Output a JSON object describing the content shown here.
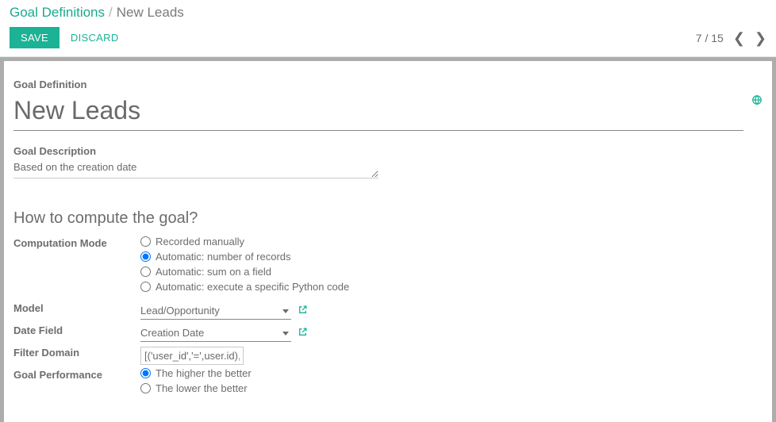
{
  "breadcrumb": {
    "parent": "Goal Definitions",
    "current": "New Leads"
  },
  "buttons": {
    "save": "SAVE",
    "discard": "DISCARD"
  },
  "pager": {
    "count": "7 / 15"
  },
  "labels": {
    "goal_definition": "Goal Definition",
    "goal_description": "Goal Description",
    "section": "How to compute the goal?",
    "computation_mode": "Computation Mode",
    "model": "Model",
    "date_field": "Date Field",
    "filter_domain": "Filter Domain",
    "goal_performance": "Goal Performance"
  },
  "values": {
    "title": "New Leads",
    "description": "Based on the creation date",
    "model": "Lead/Opportunity",
    "date_field": "Creation Date",
    "filter_domain": "[('user_id','=',user.id), '|', ('t"
  },
  "computation_mode": {
    "selected": 1,
    "options": [
      "Recorded manually",
      "Automatic: number of records",
      "Automatic: sum on a field",
      "Automatic: execute a specific Python code"
    ]
  },
  "goal_performance": {
    "selected": 0,
    "options": [
      "The higher the better",
      "The lower the better"
    ]
  }
}
